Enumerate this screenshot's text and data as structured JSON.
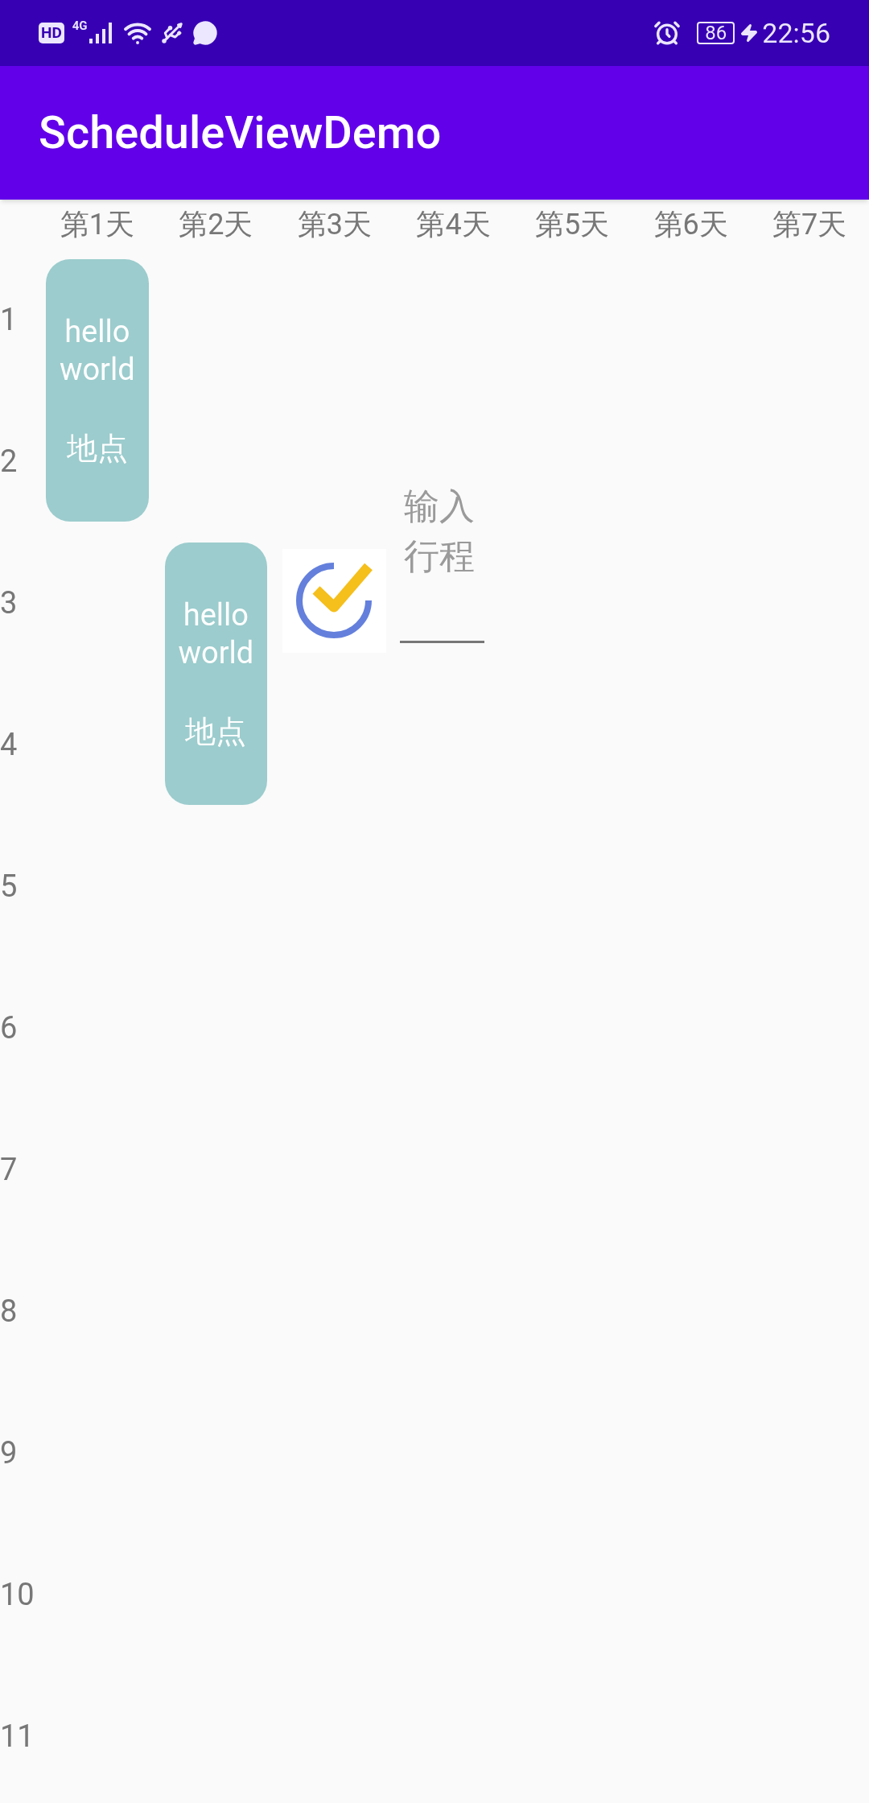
{
  "status_bar": {
    "hd": "HD",
    "network": "4G",
    "battery": "86",
    "time": "22:56"
  },
  "app_bar": {
    "title": "ScheduleViewDemo"
  },
  "days": [
    "第1天",
    "第2天",
    "第3天",
    "第4天",
    "第5天",
    "第6天",
    "第7天"
  ],
  "periods": [
    "1",
    "2",
    "3",
    "4",
    "5",
    "6",
    "7",
    "8",
    "9",
    "10",
    "11"
  ],
  "entries": [
    {
      "kind": "event",
      "title": "hello world",
      "location": "地点"
    },
    {
      "kind": "event",
      "title": "hello world",
      "location": "地点"
    },
    {
      "kind": "image"
    },
    {
      "kind": "input",
      "placeholder": "输入行程"
    }
  ]
}
